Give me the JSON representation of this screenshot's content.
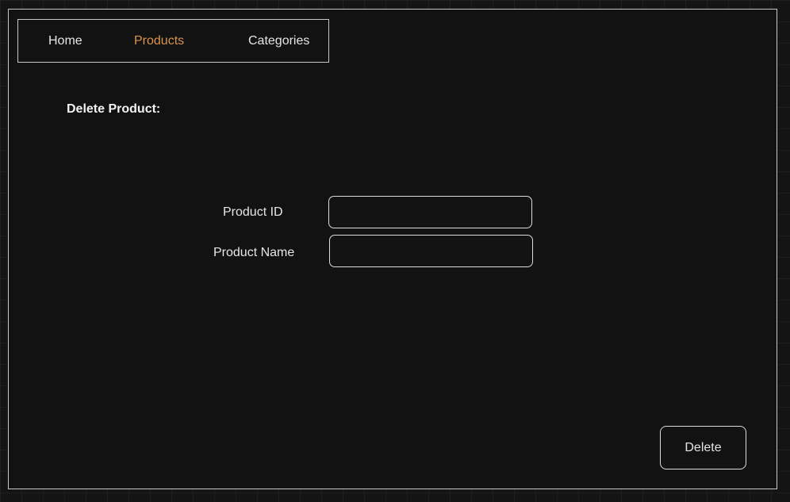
{
  "nav": {
    "items": [
      {
        "label": "Home",
        "active": false
      },
      {
        "label": "Products",
        "active": true
      },
      {
        "label": "Categories",
        "active": false
      }
    ],
    "active_color": "#d9944e",
    "default_color": "#e6e6e6"
  },
  "page": {
    "heading": "Delete Product:"
  },
  "form": {
    "product_id": {
      "label": "Product ID",
      "value": "",
      "placeholder": ""
    },
    "product_name": {
      "label": "Product Name",
      "value": "",
      "placeholder": ""
    }
  },
  "actions": {
    "delete_label": "Delete"
  },
  "colors": {
    "background": "#141414",
    "border": "#c8c8c8",
    "text": "#e6e6e6"
  }
}
